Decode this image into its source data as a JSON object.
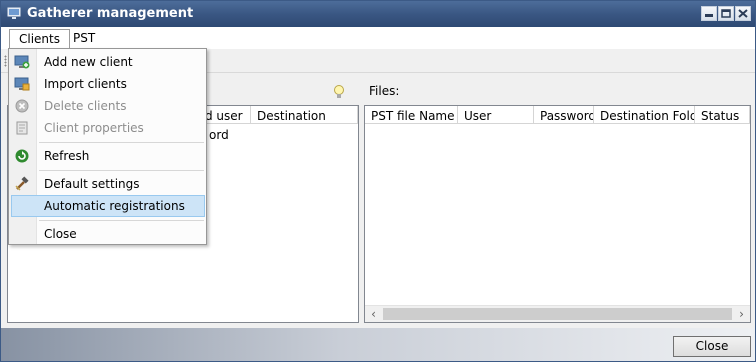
{
  "window": {
    "title": "Gatherer management",
    "icon": "monitor-icon"
  },
  "menubar": {
    "items": [
      {
        "label": "Clients"
      },
      {
        "label": "PST"
      }
    ]
  },
  "dropdown": {
    "items": [
      {
        "label": "Add new client",
        "icon": "add-client-icon",
        "enabled": true
      },
      {
        "label": "Import clients",
        "icon": "import-clients-icon",
        "enabled": true
      },
      {
        "label": "Delete clients",
        "icon": "delete-clients-icon",
        "enabled": false
      },
      {
        "label": "Client properties",
        "icon": "properties-icon",
        "enabled": false
      },
      {
        "label": "Refresh",
        "icon": "refresh-icon",
        "enabled": true
      },
      {
        "label": "Default settings",
        "icon": "hammer-icon",
        "enabled": true
      },
      {
        "label": "Automatic registrations",
        "icon": "",
        "enabled": true,
        "highlighted": true
      },
      {
        "label": "Close",
        "icon": "",
        "enabled": true
      }
    ]
  },
  "clients_table": {
    "columns": [
      "d user",
      "Destination"
    ],
    "visible_text": "ord"
  },
  "files": {
    "label": "Files:",
    "columns": [
      "PST file Name",
      "User",
      "Password",
      "Destination Folder",
      "Status"
    ]
  },
  "footer": {
    "close_label": "Close"
  },
  "colors": {
    "titlebar": "#3a5783",
    "highlight": "#cde4f7",
    "highlight_border": "#99c9ef"
  }
}
